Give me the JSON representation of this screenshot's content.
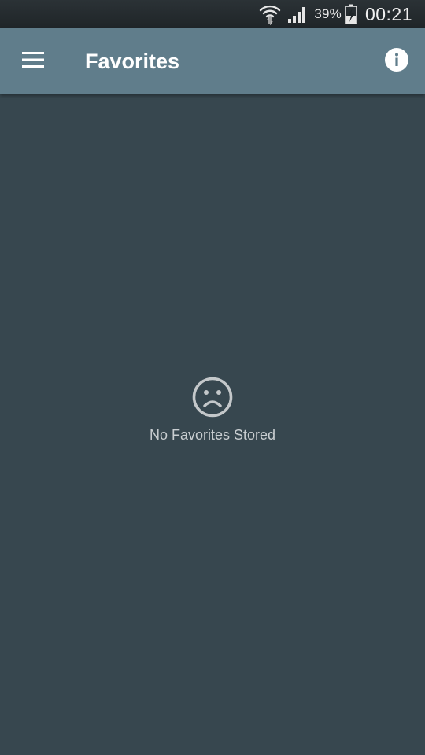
{
  "status_bar": {
    "battery_percent": "39%",
    "time": "00:21",
    "icons": [
      "wifi-icon",
      "signal-icon",
      "battery-charging-icon"
    ]
  },
  "app_bar": {
    "title": "Favorites",
    "background_color": "#607d8b",
    "icons": [
      "menu-icon",
      "info-icon"
    ]
  },
  "main": {
    "background_color": "#37474f",
    "empty_state": {
      "icon": "sad-face-icon",
      "message": "No Favorites Stored"
    }
  }
}
